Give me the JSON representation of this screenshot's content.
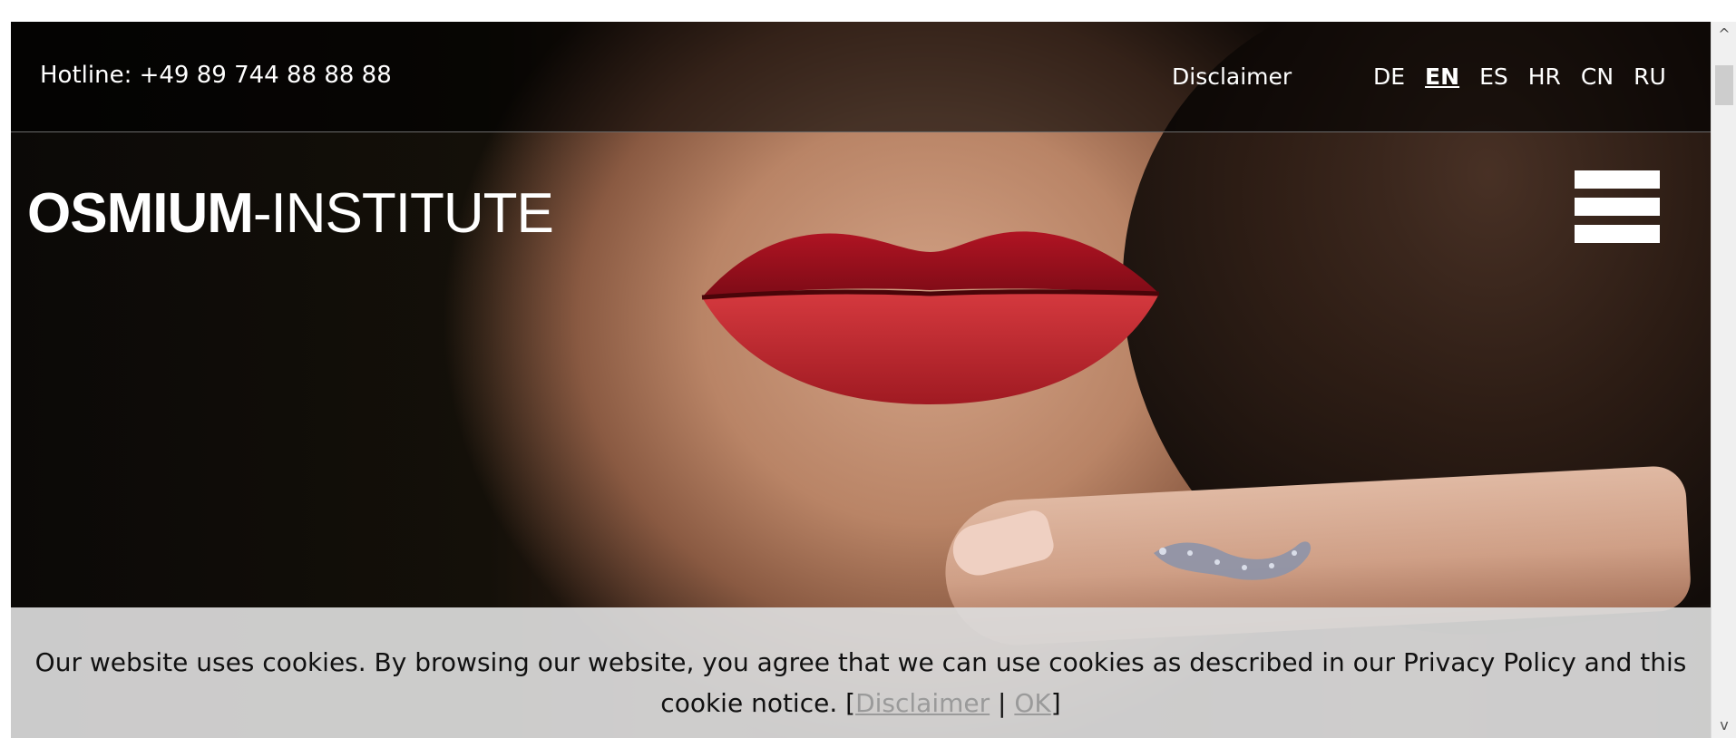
{
  "topbar": {
    "hotline": "Hotline: +49 89 744 88 88 88",
    "disclaimer": "Disclaimer",
    "languages": [
      {
        "code": "DE",
        "active": false
      },
      {
        "code": "EN",
        "active": true
      },
      {
        "code": "ES",
        "active": false
      },
      {
        "code": "HR",
        "active": false
      },
      {
        "code": "CN",
        "active": false
      },
      {
        "code": "RU",
        "active": false
      }
    ]
  },
  "logo": {
    "bold": "OSMIUM",
    "rest": "-INSTITUTE"
  },
  "cookie": {
    "text": "Our website uses cookies. By browsing our website, you agree that we can use cookies as described in our Privacy Policy and this cookie notice. [",
    "disclaimer_link": "Disclaimer",
    "separator": " | ",
    "ok_link": "OK",
    "close_bracket": "]"
  },
  "colors": {
    "text": "#ffffff",
    "banner": "#dcdcdc",
    "link_muted": "#9a9a9a"
  },
  "icons": {
    "menu": "hamburger-menu-icon"
  }
}
